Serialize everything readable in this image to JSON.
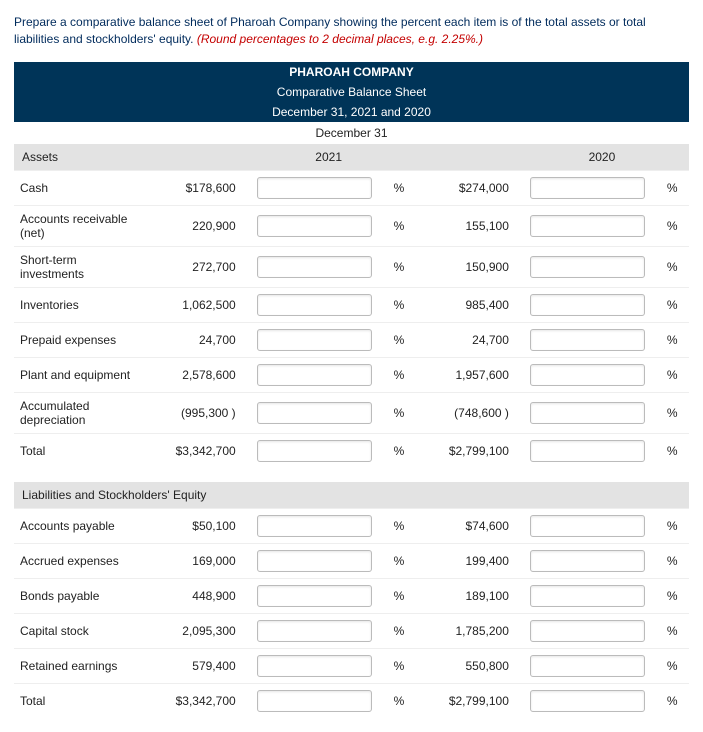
{
  "instruction_main": "Prepare a comparative balance sheet of Pharoah Company showing the percent each item is of the total assets or total liabilities and stockholders' equity. ",
  "instruction_red": "(Round percentages to 2 decimal places, e.g. 2.25%.)",
  "header": {
    "company": "PHAROAH COMPANY",
    "title": "Comparative Balance Sheet",
    "dates": "December 31, 2021 and 2020",
    "period": "December 31"
  },
  "years": {
    "y1": "2021",
    "y2": "2020"
  },
  "sections": {
    "assets_title": "Assets",
    "liab_title": "Liabilities and Stockholders' Equity"
  },
  "pct": "%",
  "rows": {
    "cash": {
      "label": "Cash",
      "a21": "$178,600",
      "a20": "$274,000"
    },
    "ar": {
      "label": "Accounts receivable (net)",
      "a21": "220,900",
      "a20": "155,100"
    },
    "sti": {
      "label": "Short-term investments",
      "a21": "272,700",
      "a20": "150,900"
    },
    "inv": {
      "label": "Inventories",
      "a21": "1,062,500",
      "a20": "985,400"
    },
    "ppd": {
      "label": "Prepaid expenses",
      "a21": "24,700",
      "a20": "24,700"
    },
    "pe": {
      "label": "Plant and equipment",
      "a21": "2,578,600",
      "a20": "1,957,600"
    },
    "ad": {
      "label": "Accumulated depreciation",
      "a21": "(995,300  )",
      "a20": "(748,600  )"
    },
    "atot": {
      "label": "Total",
      "a21": "$3,342,700",
      "a20": "$2,799,100"
    },
    "ap": {
      "label": "Accounts payable",
      "a21": "$50,100",
      "a20": "$74,600"
    },
    "ae": {
      "label": "Accrued expenses",
      "a21": "169,000",
      "a20": "199,400"
    },
    "bp": {
      "label": "Bonds payable",
      "a21": "448,900",
      "a20": "189,100"
    },
    "cs": {
      "label": "Capital stock",
      "a21": "2,095,300",
      "a20": "1,785,200"
    },
    "re": {
      "label": "Retained earnings",
      "a21": "579,400",
      "a20": "550,800"
    },
    "ltot": {
      "label": "Total",
      "a21": "$3,342,700",
      "a20": "$2,799,100"
    }
  }
}
